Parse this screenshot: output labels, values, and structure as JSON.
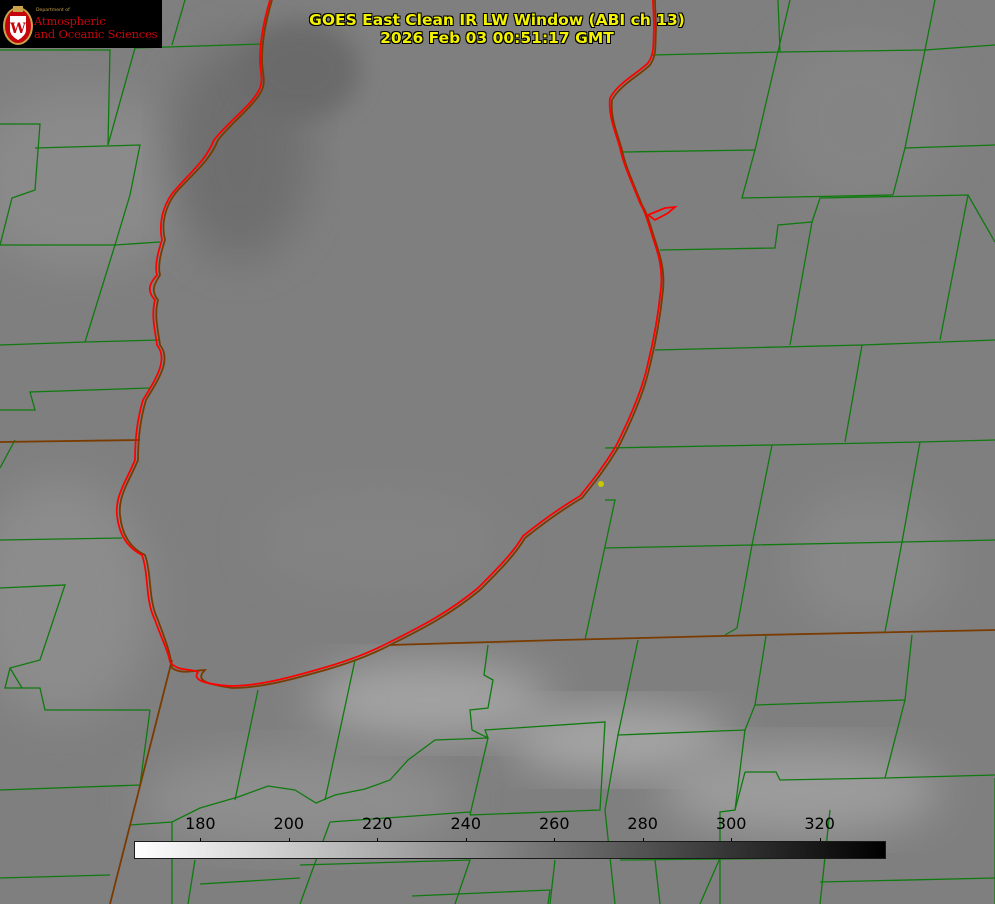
{
  "header": {
    "title_line1": "GOES East Clean IR LW Window (ABI ch 13)",
    "title_line2": "2026 Feb 03 00:51:17 GMT"
  },
  "logo": {
    "dept_text": "Department of",
    "line1": "Atmospheric",
    "line2": "and Oceanic Sciences",
    "seal_letter": "W"
  },
  "colorbar": {
    "ticks": [
      "180",
      "200",
      "220",
      "240",
      "260",
      "280",
      "300",
      "320"
    ],
    "range": [
      165,
      335
    ],
    "gradient": "white-to-black"
  },
  "colors": {
    "county_lines": "#0f7a0f",
    "coastline": "#e80000",
    "state_lines": "#7a3b00",
    "title_text": "#f2f200",
    "marker": "#c8c800"
  }
}
